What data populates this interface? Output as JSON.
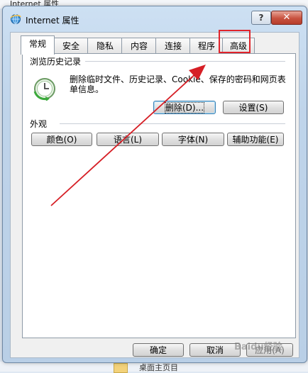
{
  "background": {
    "top_text": "Internet 属性",
    "bottom_text": "桌面主页目"
  },
  "window": {
    "title": "Internet 属性",
    "help_label": "?",
    "close_label": "✕",
    "icon": "ie-globe-icon"
  },
  "tabs": [
    {
      "label": "常规",
      "active": true
    },
    {
      "label": "安全",
      "active": false
    },
    {
      "label": "隐私",
      "active": false
    },
    {
      "label": "内容",
      "active": false
    },
    {
      "label": "连接",
      "active": false
    },
    {
      "label": "程序",
      "active": false
    },
    {
      "label": "高级",
      "active": false
    }
  ],
  "history": {
    "group_title": "浏览历史记录",
    "description": "删除临时文件、历史记录、Cookie、保存的密码和网页表单信息。",
    "delete_label": "删除(D)...",
    "settings_label": "设置(S)",
    "icon": "history-clock-icon"
  },
  "appearance": {
    "group_title": "外观",
    "colors_label": "颜色(O)",
    "languages_label": "语言(L)",
    "fonts_label": "字体(N)",
    "accessibility_label": "辅助功能(E)"
  },
  "footer": {
    "ok_label": "确定",
    "cancel_label": "取消",
    "apply_label": "应用(A)"
  },
  "annotation": {
    "highlight_color": "#e0242b",
    "watermark": "Baidu经验"
  }
}
